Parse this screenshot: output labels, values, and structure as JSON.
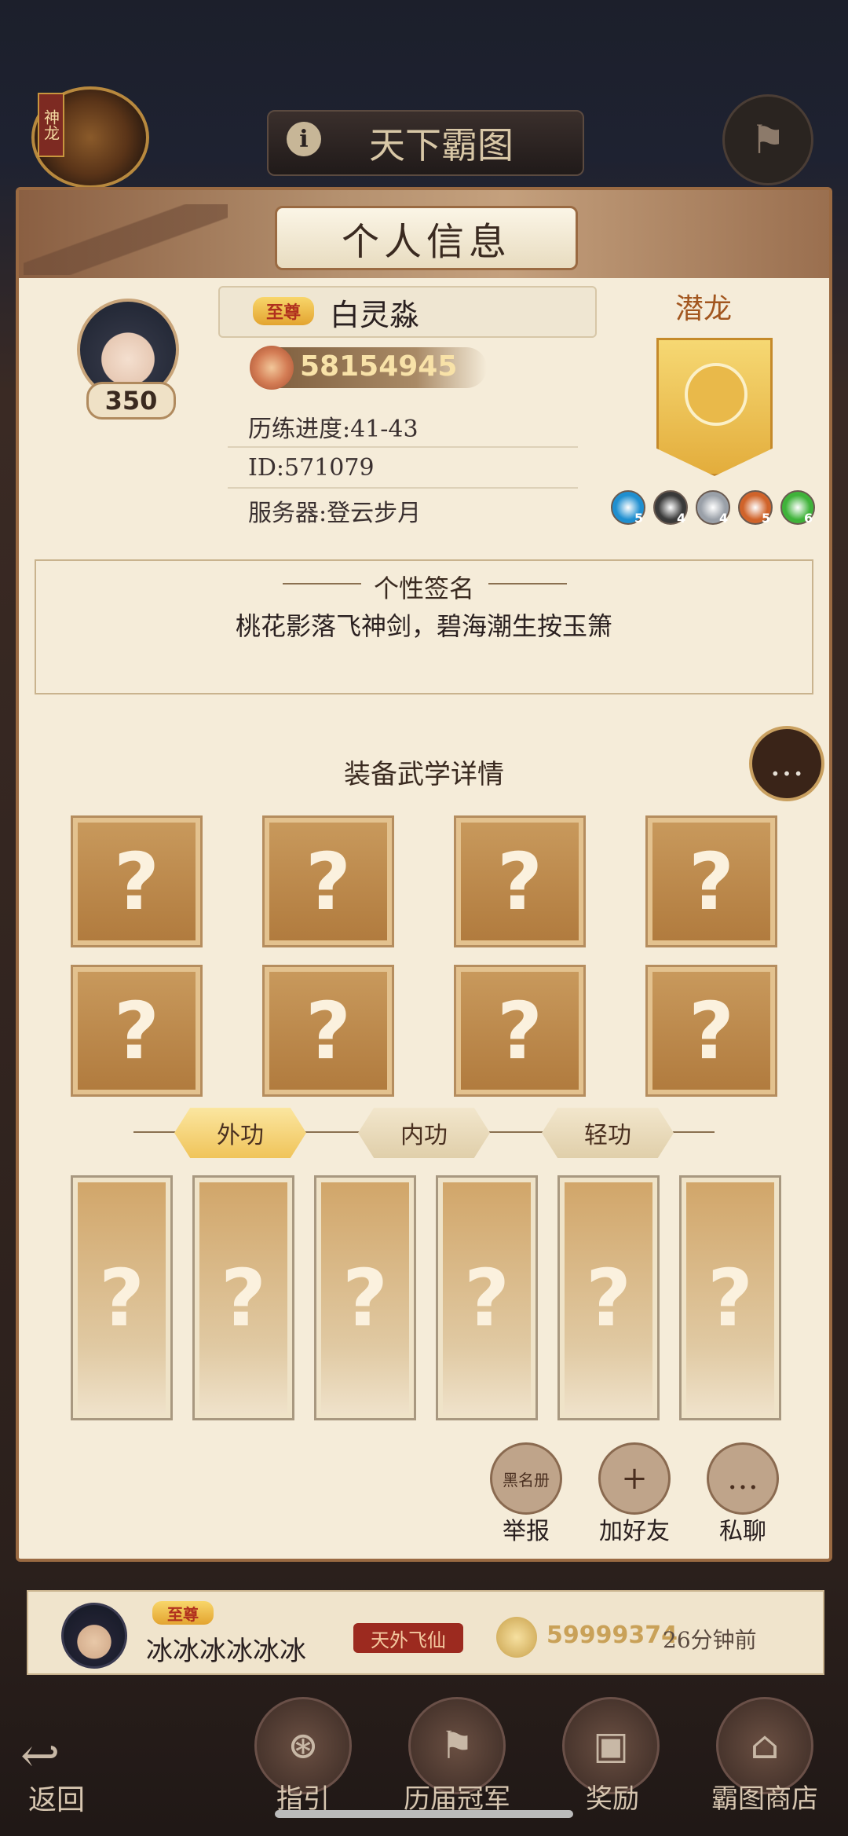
{
  "top": {
    "badge_tag": "神龙",
    "title": "天下霸图"
  },
  "panel": {
    "header_title": "个人信息",
    "level": "350",
    "vip_tag": "至尊",
    "player_name": "白灵淼",
    "power": "58154945",
    "progress": "历练进度:41-43",
    "id": "ID:571079",
    "server": "服务器:登云步月",
    "rank_title": "潜龙",
    "gems": [
      {
        "count": "5",
        "color": "#1f8fd0"
      },
      {
        "count": "4",
        "color": "#3a3a3a"
      },
      {
        "count": "4",
        "color": "#9aa0a8"
      },
      {
        "count": "5",
        "color": "#d0632a"
      },
      {
        "count": "6",
        "color": "#3fb33a"
      }
    ],
    "signature_title": "个性签名",
    "signature_text": "桃花影落飞神剑，碧海潮生按玉箫",
    "equip_title": "装备武学详情",
    "slots": [
      "?",
      "?",
      "?",
      "?",
      "?",
      "?",
      "?",
      "?"
    ],
    "tabs": [
      "外功",
      "内功",
      "轻功"
    ],
    "cards": [
      "?",
      "?",
      "?",
      "?",
      "?",
      "?"
    ],
    "actions": [
      {
        "label": "举报",
        "icon": "黑名册"
      },
      {
        "label": "加好友",
        "icon": "+"
      },
      {
        "label": "私聊",
        "icon": "…"
      }
    ]
  },
  "record": {
    "vip_tag": "至尊",
    "name": "冰冰冰冰冰冰",
    "title": "天外飞仙",
    "power": "59999374",
    "time": "26分钟前"
  },
  "nav": {
    "back": "返回",
    "items": [
      "指引",
      "历届冠军",
      "奖励",
      "霸图商店"
    ]
  }
}
